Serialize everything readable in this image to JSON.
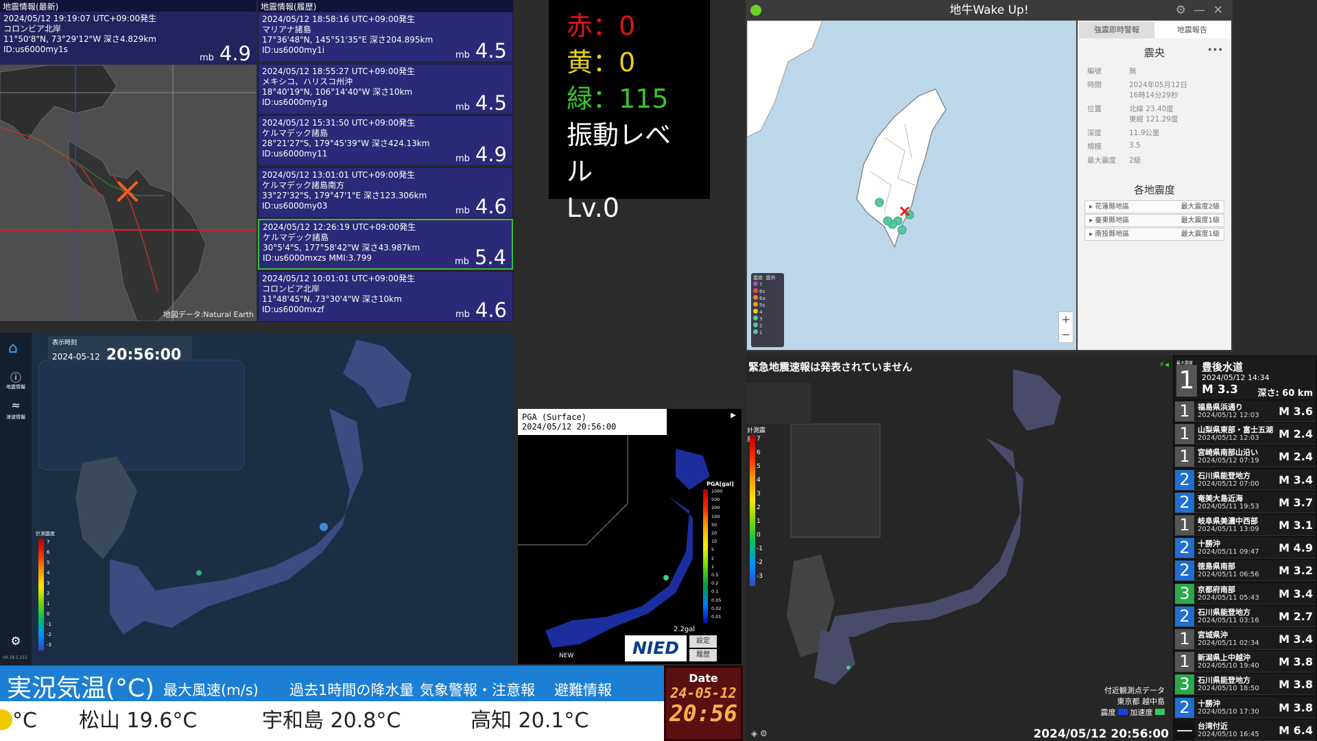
{
  "latest": {
    "header": "地震情報(最新)",
    "time": "2024/05/12  19:19:07  UTC+09:00発生",
    "place": "コロンビア北岸",
    "coords": "11°50'8\"N,  73°29'12\"W   深さ4.829km",
    "id": "ID:us6000my1s",
    "mag_type": "mb",
    "mag": "4.9"
  },
  "history": {
    "header": "地震情報(履歴)",
    "items": [
      {
        "time": "2024/05/12  18:58:16  UTC+09:00発生",
        "place": "マリアナ諸島",
        "coords": "17°36'48\"N,  145°51'35\"E   深さ204.895km",
        "id": "ID:us6000my1i",
        "mag": "4.5"
      },
      {
        "time": "2024/05/12  18:55:27  UTC+09:00発生",
        "place": "メキシコ、ハリスコ州沖",
        "coords": "18°40'19\"N,  106°14'40\"W   深さ10km",
        "id": "ID:us6000my1g",
        "mag": "4.5"
      },
      {
        "time": "2024/05/12  15:31:50  UTC+09:00発生",
        "place": "ケルマデック諸島",
        "coords": "28°21'27\"S,  179°45'39\"W   深さ424.13km",
        "id": "ID:us6000my11",
        "mag": "4.9"
      },
      {
        "time": "2024/05/12  13:01:01  UTC+09:00発生",
        "place": "ケルマデック諸島南方",
        "coords": "33°27'32\"S,  179°47'1\"E   深さ123.306km",
        "id": "ID:us6000my03",
        "mag": "4.6"
      },
      {
        "time": "2024/05/12  12:26:19  UTC+09:00発生",
        "place": "ケルマデック諸島",
        "coords": "30°5'4\"S,  177°58'42\"W   深さ43.987km",
        "id": "ID:us6000mxzs MMI:3.799",
        "mag": "5.4"
      },
      {
        "time": "2024/05/12  10:01:01  UTC+09:00発生",
        "place": "コロンビア北岸",
        "coords": "11°48'45\"N,  73°30'4\"W   深さ10km",
        "id": "ID:us6000mxzf",
        "mag": "4.6"
      }
    ],
    "mag_type": "mb"
  },
  "map_credit": "地図データ:Natural Earth",
  "counter": {
    "red": "赤：0",
    "yellow": "黄：0",
    "green": "緑：115",
    "level_label": "振動レベル",
    "level": "Lv.0",
    "colors": {
      "red": "#e11515",
      "yellow": "#e6d21a",
      "green": "#39c62b"
    }
  },
  "wakeup": {
    "title": "地牛Wake Up!",
    "tab1": "強震即時警報",
    "tab2": "地震報告",
    "epicenter_title": "震央",
    "more": "•••",
    "rows": [
      {
        "k": "編號",
        "v": "無"
      },
      {
        "k": "時間",
        "v": "2024年05月12日",
        "v2": "16時14分29秒"
      },
      {
        "k": "位置",
        "v": "北緯 23.40度",
        "v2": "東經 121.29度"
      },
      {
        "k": "深度",
        "v": "11.9公里"
      },
      {
        "k": "規模",
        "v": "3.5"
      },
      {
        "k": "最大震度",
        "v": "2級"
      }
    ],
    "regions_title": "各地震度",
    "regions": [
      {
        "name": "▸ 花蓮縣地區",
        "max": "最大震度2級"
      },
      {
        "name": "▸ 臺東縣地區",
        "max": "最大震度1級"
      },
      {
        "name": "▸ 南投縣地區",
        "max": "最大震度1級"
      }
    ],
    "legend_h1": "震度",
    "legend_h2": "震央",
    "legend": [
      "7",
      "6s",
      "6a",
      "5s",
      "4",
      "3",
      "2",
      "1"
    ],
    "zoom_in": "+",
    "zoom_out": "−"
  },
  "jp_left": {
    "time_label": "表示時刻",
    "date": "2024-05-12",
    "time": "20:56:00",
    "nav1": "地震情報",
    "nav2": "津波情報",
    "scale_title": "計測震度",
    "scale": [
      "7",
      "6",
      "5",
      "4",
      "3",
      "2",
      "1",
      "0",
      "-1",
      "-2",
      "-3"
    ],
    "version": "v0.18.1.211"
  },
  "pga": {
    "title": "PGA (Surface)",
    "time": "2024/05/12 20:56:00",
    "unit": "PGA[gal]",
    "scale": [
      "1000",
      "500",
      "200",
      "100",
      "50",
      "20",
      "10",
      "5",
      "2",
      "1",
      "0.5",
      "0.2",
      "0.1",
      "0.05",
      "0.02",
      "0.01"
    ],
    "value": "2.2gal",
    "btn1": "設定",
    "btn2": "履歴",
    "new": "NEW",
    "logo": "NIED"
  },
  "ticker": {
    "main": "実況気温(°C)",
    "tabs": [
      "最大風速(m/s)",
      "過去1時間の降水量",
      "気象警報・注意報",
      "避難情報"
    ],
    "items": [
      "°C",
      "松山 19.6°C",
      "宇和島 20.8°C",
      "高知 20.1°C"
    ]
  },
  "date_box": {
    "label": "Date",
    "date": "24-05-12",
    "time": "20:56"
  },
  "jp_right": {
    "status": "緊急地震速報は発表されていません",
    "scale_title": "計測震度",
    "scale": [
      "7",
      "6",
      "5",
      "4",
      "3",
      "2",
      "1",
      "0",
      "-1",
      "-2",
      "-3"
    ],
    "nearby_label": "付近観測点データ",
    "nearby_place": "東京都 越中島",
    "legend1": "震度",
    "legend2": "加速度",
    "datetime": "2024/05/12 20:56:00"
  },
  "eq_list": {
    "head": "最大震度",
    "top": {
      "int": "1",
      "name": "豊後水道",
      "time": "2024/05/12 14:34",
      "mag": "M 3.3",
      "depth": "深さ: 60 km"
    },
    "items": [
      {
        "int": "1",
        "name": "福島県浜通り",
        "time": "2024/05/12 12:03",
        "mag": "M 3.6",
        "color": "#555"
      },
      {
        "int": "1",
        "name": "山梨県東部・富士五湖",
        "time": "2024/05/12 12:03",
        "mag": "M 2.4",
        "color": "#555"
      },
      {
        "int": "1",
        "name": "宮崎県南部山沿い",
        "time": "2024/05/12 07:19",
        "mag": "M 2.4",
        "color": "#555"
      },
      {
        "int": "2",
        "name": "石川県能登地方",
        "time": "2024/05/12 07:00",
        "mag": "M 3.4",
        "color": "#1f6fd0"
      },
      {
        "int": "2",
        "name": "奄美大島近海",
        "time": "2024/05/11 19:53",
        "mag": "M 3.7",
        "color": "#1f6fd0"
      },
      {
        "int": "1",
        "name": "岐阜県美濃中西部",
        "time": "2024/05/11 13:09",
        "mag": "M 3.1",
        "color": "#555"
      },
      {
        "int": "2",
        "name": "十勝沖",
        "time": "2024/05/11 09:47",
        "mag": "M 4.9",
        "color": "#1f6fd0"
      },
      {
        "int": "2",
        "name": "徳島県南部",
        "time": "2024/05/11 06:56",
        "mag": "M 3.2",
        "color": "#1f6fd0"
      },
      {
        "int": "3",
        "name": "京都府南部",
        "time": "2024/05/11 05:43",
        "mag": "M 3.4",
        "color": "#2aa84a"
      },
      {
        "int": "2",
        "name": "石川県能登地方",
        "time": "2024/05/11 03:16",
        "mag": "M 2.7",
        "color": "#1f6fd0"
      },
      {
        "int": "1",
        "name": "宮城県沖",
        "time": "2024/05/11 02:34",
        "mag": "M 3.4",
        "color": "#555"
      },
      {
        "int": "1",
        "name": "新潟県上中越沖",
        "time": "2024/05/10 19:40",
        "mag": "M 3.8",
        "color": "#555"
      },
      {
        "int": "3",
        "name": "石川県能登地方",
        "time": "2024/05/10 18:50",
        "mag": "M 3.8",
        "color": "#2aa84a"
      },
      {
        "int": "2",
        "name": "十勝沖",
        "time": "2024/05/10 17:30",
        "mag": "M 3.8",
        "color": "#1f6fd0"
      },
      {
        "int": "—",
        "name": "台湾付近",
        "time": "2024/05/10 16:45",
        "mag": "M 6.4",
        "color": "#111"
      }
    ]
  }
}
